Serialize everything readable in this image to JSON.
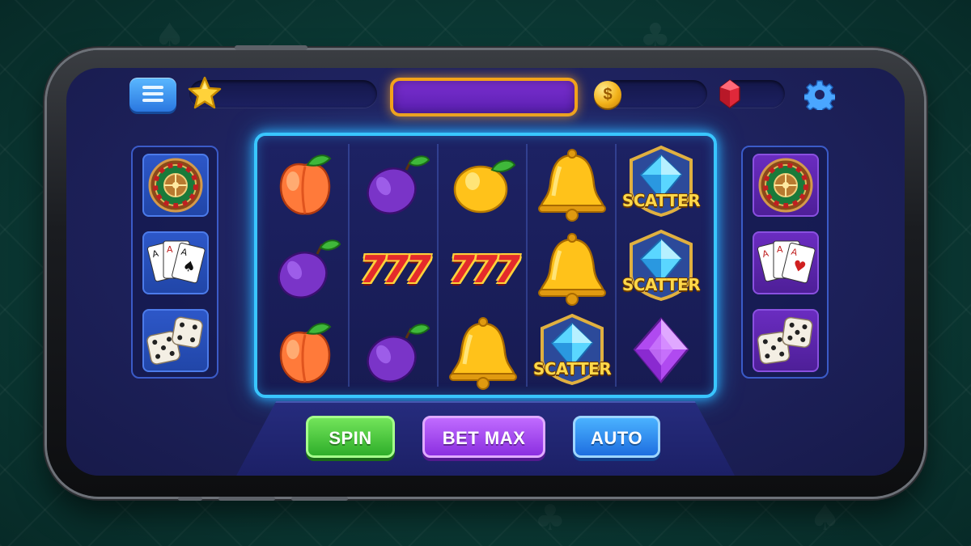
{
  "top_bar": {
    "menu_icon": "menu-icon",
    "star_icon": "star-icon",
    "coin_symbol": "$",
    "gem_icon": "ruby-gem-icon",
    "settings_icon": "gear-icon"
  },
  "side_left": [
    "roulette-wheel-icon",
    "playing-cards-icon",
    "dice-icon"
  ],
  "side_right": [
    "roulette-wheel-icon",
    "playing-cards-icon",
    "dice-icon"
  ],
  "reels": {
    "columns": [
      [
        "peach",
        "plum",
        "peach"
      ],
      [
        "plum",
        "777",
        "plum"
      ],
      [
        "lemon",
        "777",
        "bell"
      ],
      [
        "bell",
        "bell",
        "scatter"
      ],
      [
        "scatter",
        "scatter",
        "purple-gem"
      ]
    ],
    "seven_label": "777",
    "scatter_label": "SCATTER"
  },
  "controls": {
    "spin_label": "SPIN",
    "bet_max_label": "BET MAX",
    "auto_label": "AUTO"
  },
  "colors": {
    "spin": "#3cc43a",
    "bet_max": "#9a3ee8",
    "auto": "#2a86f0",
    "reel_glow": "#39c6ff",
    "banner_border": "#f2a21a"
  }
}
